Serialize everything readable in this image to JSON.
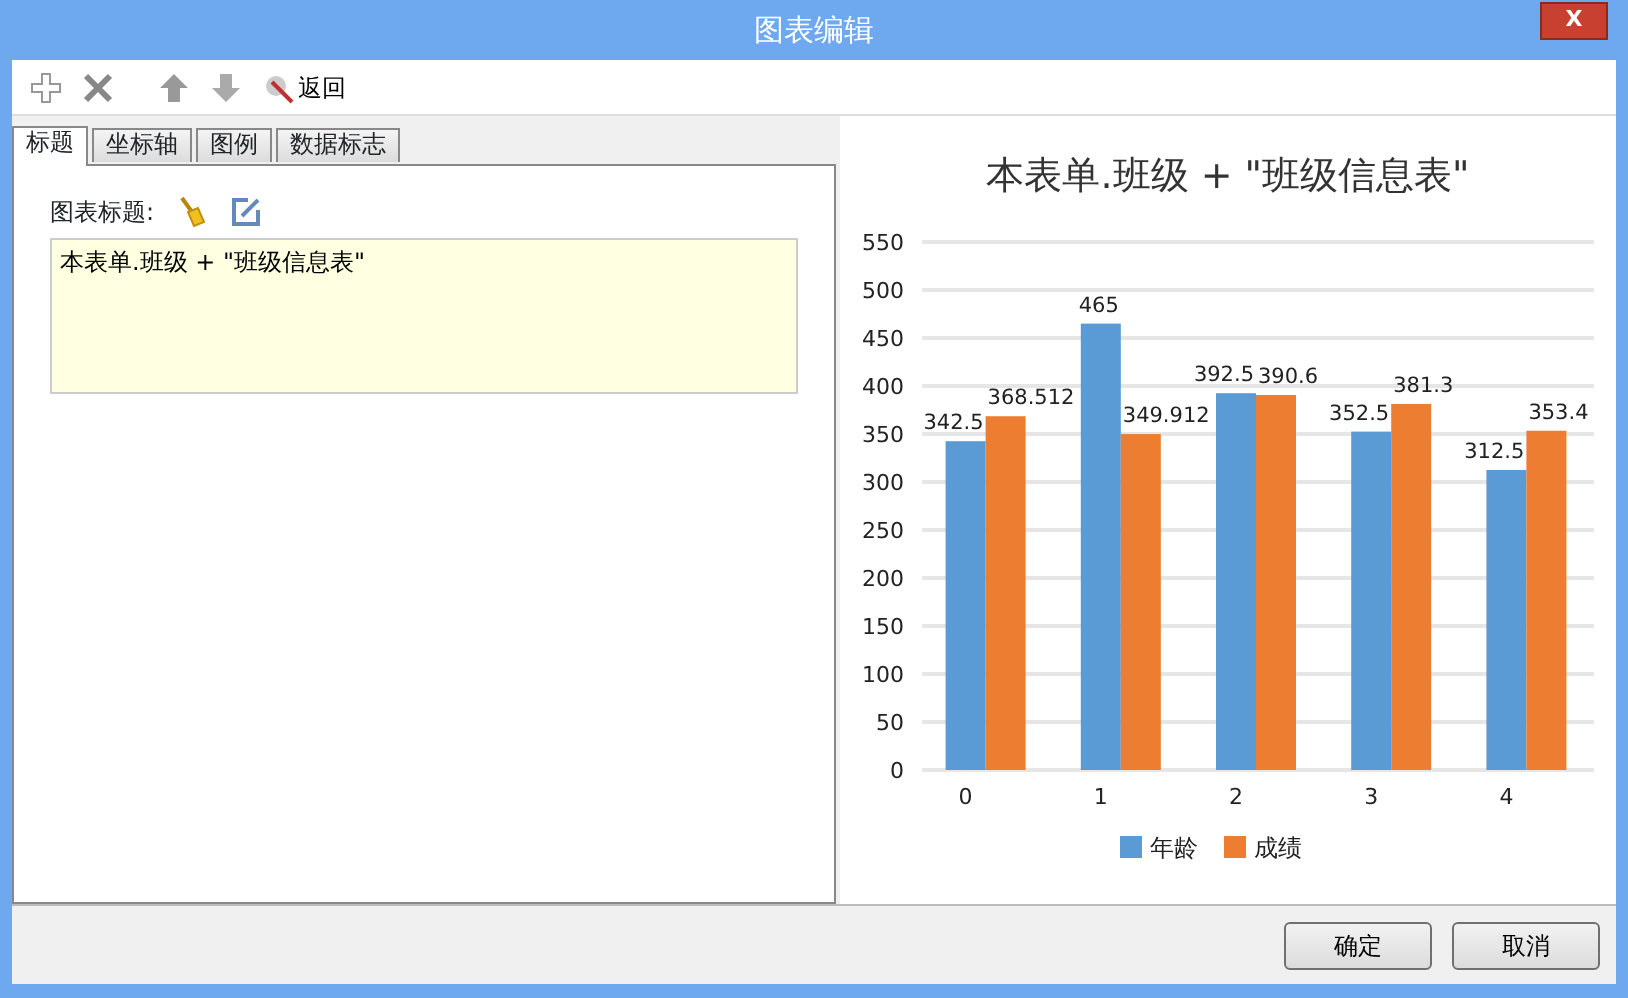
{
  "window": {
    "title": "图表编辑",
    "close": "X"
  },
  "toolbar": [
    {
      "kind": "add"
    },
    {
      "kind": "delete"
    },
    {
      "kind": "up"
    },
    {
      "kind": "down"
    },
    {
      "kind": "back",
      "label": "返回"
    }
  ],
  "tabs": [
    {
      "label": "标题",
      "selected": true
    },
    {
      "label": "坐标轴",
      "selected": false
    },
    {
      "label": "图例",
      "selected": false
    },
    {
      "label": "数据标志",
      "selected": false
    }
  ],
  "title_field": {
    "label": "图表标题:",
    "value": "本表单.班级 + \"班级信息表\""
  },
  "chart": {
    "chart_data": {
      "type": "bar",
      "title": "本表单.班级 + \"班级信息表\"",
      "categories": [
        "0",
        "1",
        "2",
        "3",
        "4"
      ],
      "series": [
        {
          "name": "年龄",
          "color": "#5b9bd5",
          "values": [
            342.5,
            465,
            392.5,
            352.5,
            312.5
          ]
        },
        {
          "name": "成绩",
          "color": "#ed7d31",
          "values": [
            368.512,
            349.912,
            390.6,
            381.3,
            353.4
          ]
        }
      ],
      "ylim": [
        0,
        550
      ],
      "yticks": [
        0,
        50,
        100,
        150,
        200,
        250,
        300,
        350,
        400,
        450,
        500,
        550
      ],
      "data_labels": true,
      "grid": true,
      "legend": "bottom"
    }
  },
  "buttons": [
    "确定",
    "取消"
  ]
}
